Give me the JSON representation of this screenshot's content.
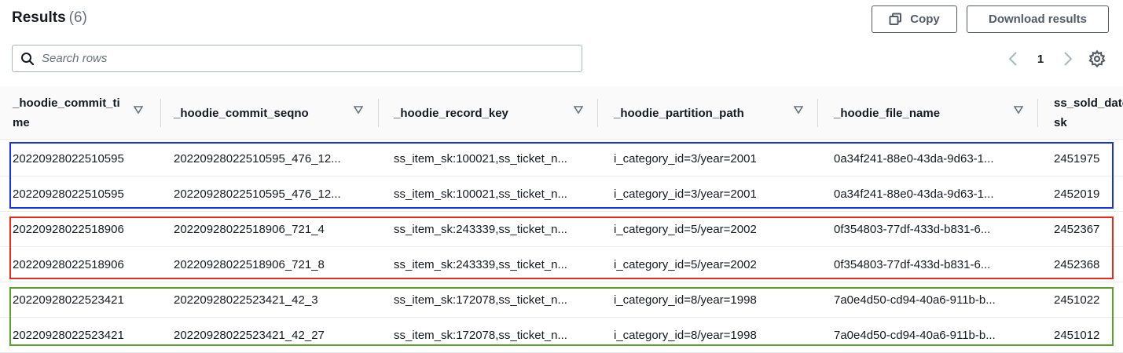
{
  "header": {
    "title": "Results",
    "count": "(6)",
    "copy_label": "Copy",
    "download_label": "Download results"
  },
  "search": {
    "placeholder": "Search rows",
    "icon": "search-icon"
  },
  "pagination": {
    "current_page": "1",
    "prev_icon": "chevron-left-icon",
    "next_icon": "chevron-right-icon",
    "settings_icon": "gear-icon"
  },
  "table": {
    "columns": [
      {
        "line1": "_hoodie_commit_ti",
        "line2": "me"
      },
      {
        "line1": "_hoodie_commit_seqno",
        "line2": ""
      },
      {
        "line1": "_hoodie_record_key",
        "line2": ""
      },
      {
        "line1": "_hoodie_partition_path",
        "line2": ""
      },
      {
        "line1": "_hoodie_file_name",
        "line2": ""
      },
      {
        "line1": "ss_sold_date_",
        "line2": "sk"
      }
    ],
    "rows": [
      [
        "20220928022510595",
        "20220928022510595_476_12...",
        "ss_item_sk:100021,ss_ticket_n...",
        "i_category_id=3/year=2001",
        "0a34f241-88e0-43da-9d63-1...",
        "2451975"
      ],
      [
        "20220928022510595",
        "20220928022510595_476_12...",
        "ss_item_sk:100021,ss_ticket_n...",
        "i_category_id=3/year=2001",
        "0a34f241-88e0-43da-9d63-1...",
        "2452019"
      ],
      [
        "20220928022518906",
        "20220928022518906_721_4",
        "ss_item_sk:243339,ss_ticket_n...",
        "i_category_id=5/year=2002",
        "0f354803-77df-433d-b831-6...",
        "2452367"
      ],
      [
        "20220928022518906",
        "20220928022518906_721_8",
        "ss_item_sk:243339,ss_ticket_n...",
        "i_category_id=5/year=2002",
        "0f354803-77df-433d-b831-6...",
        "2452368"
      ],
      [
        "20220928022523421",
        "20220928022523421_42_3",
        "ss_item_sk:172078,ss_ticket_n...",
        "i_category_id=8/year=1998",
        "7a0e4d50-cd94-40a6-911b-b...",
        "2451022"
      ],
      [
        "20220928022523421",
        "20220928022523421_42_27",
        "ss_item_sk:172078,ss_ticket_n...",
        "i_category_id=8/year=1998",
        "7a0e4d50-cd94-40a6-911b-b...",
        "2451012"
      ]
    ]
  },
  "highlights": {
    "group1_color": "#1432e6",
    "group2_color": "#e8291c",
    "group3_color": "#5aa02c"
  }
}
